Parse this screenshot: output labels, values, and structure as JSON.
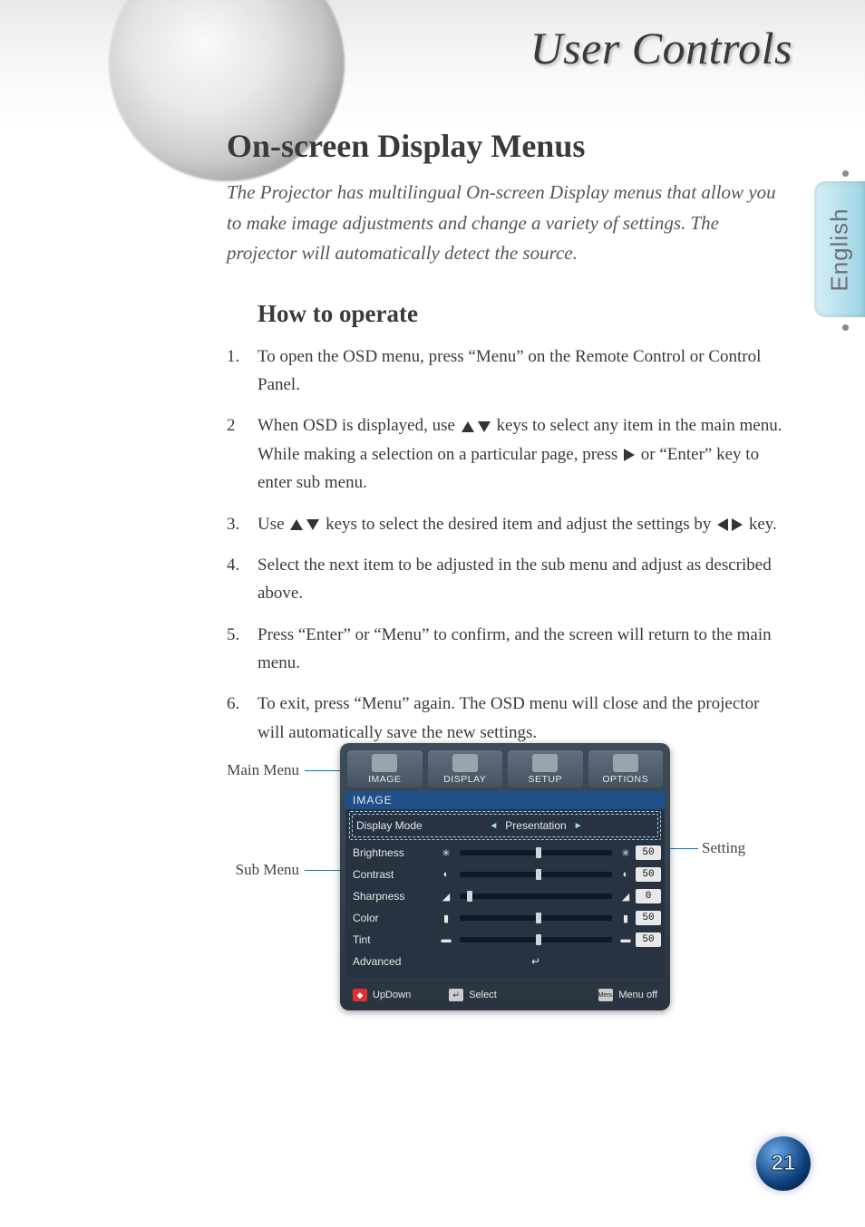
{
  "banner": {
    "title": "User Controls"
  },
  "language_tab": "English",
  "heading": "On-screen Display Menus",
  "intro": "The Projector has multilingual On-screen Display menus that allow you to make image adjustments and change a variety of settings. The projector will automatically detect the source.",
  "subheading": "How to operate",
  "steps": [
    {
      "num": "1.",
      "before": "To open the OSD menu, press “Menu” on the Remote Control or Control Panel."
    },
    {
      "num": "2",
      "before": "When OSD is displayed, use ",
      "arrows1": [
        "up",
        "down"
      ],
      "mid": " keys to select any item in the main menu.  While making a selection on a particular page, press ",
      "arrows2": [
        "right"
      ],
      "after": " or “Enter” key to enter sub menu."
    },
    {
      "num": "3.",
      "before": "Use ",
      "arrows1": [
        "up",
        "down"
      ],
      "mid": " keys to select the desired item and adjust the settings by ",
      "arrows2": [
        "left",
        "right"
      ],
      "after": " key."
    },
    {
      "num": "4.",
      "before": "Select the next item to be adjusted in the sub menu and adjust as described above."
    },
    {
      "num": "5.",
      "before": "Press “Enter” or “Menu” to confirm, and the screen will return to the main menu."
    },
    {
      "num": "6.",
      "before": "To exit, press “Menu” again.  The OSD menu will close and the projector will automatically save the new settings."
    }
  ],
  "labels": {
    "main_menu": "Main Menu",
    "sub_menu": "Sub Menu",
    "setting": "Setting"
  },
  "osd": {
    "tabs": [
      "IMAGE",
      "DISPLAY",
      "SETUP",
      "OPTIONS"
    ],
    "header": "IMAGE",
    "rows": [
      {
        "label": "Display Mode",
        "type": "select",
        "value": "Presentation"
      },
      {
        "label": "Brightness",
        "type": "slider",
        "value": "50",
        "pos": 50,
        "icon": "✳"
      },
      {
        "label": "Contrast",
        "type": "slider",
        "value": "50",
        "pos": 50,
        "icon": "◐"
      },
      {
        "label": "Sharpness",
        "type": "slider",
        "value": "0",
        "pos": 5,
        "icon": "◢"
      },
      {
        "label": "Color",
        "type": "slider",
        "value": "50",
        "pos": 50,
        "icon": "▮"
      },
      {
        "label": "Tint",
        "type": "slider",
        "value": "50",
        "pos": 50,
        "icon": "▬"
      },
      {
        "label": "Advanced",
        "type": "enter"
      }
    ],
    "footer": {
      "updown": "UpDown",
      "select": "Select",
      "menu_key": "Menu",
      "menu_off": "Menu off"
    }
  },
  "page_number": "21"
}
